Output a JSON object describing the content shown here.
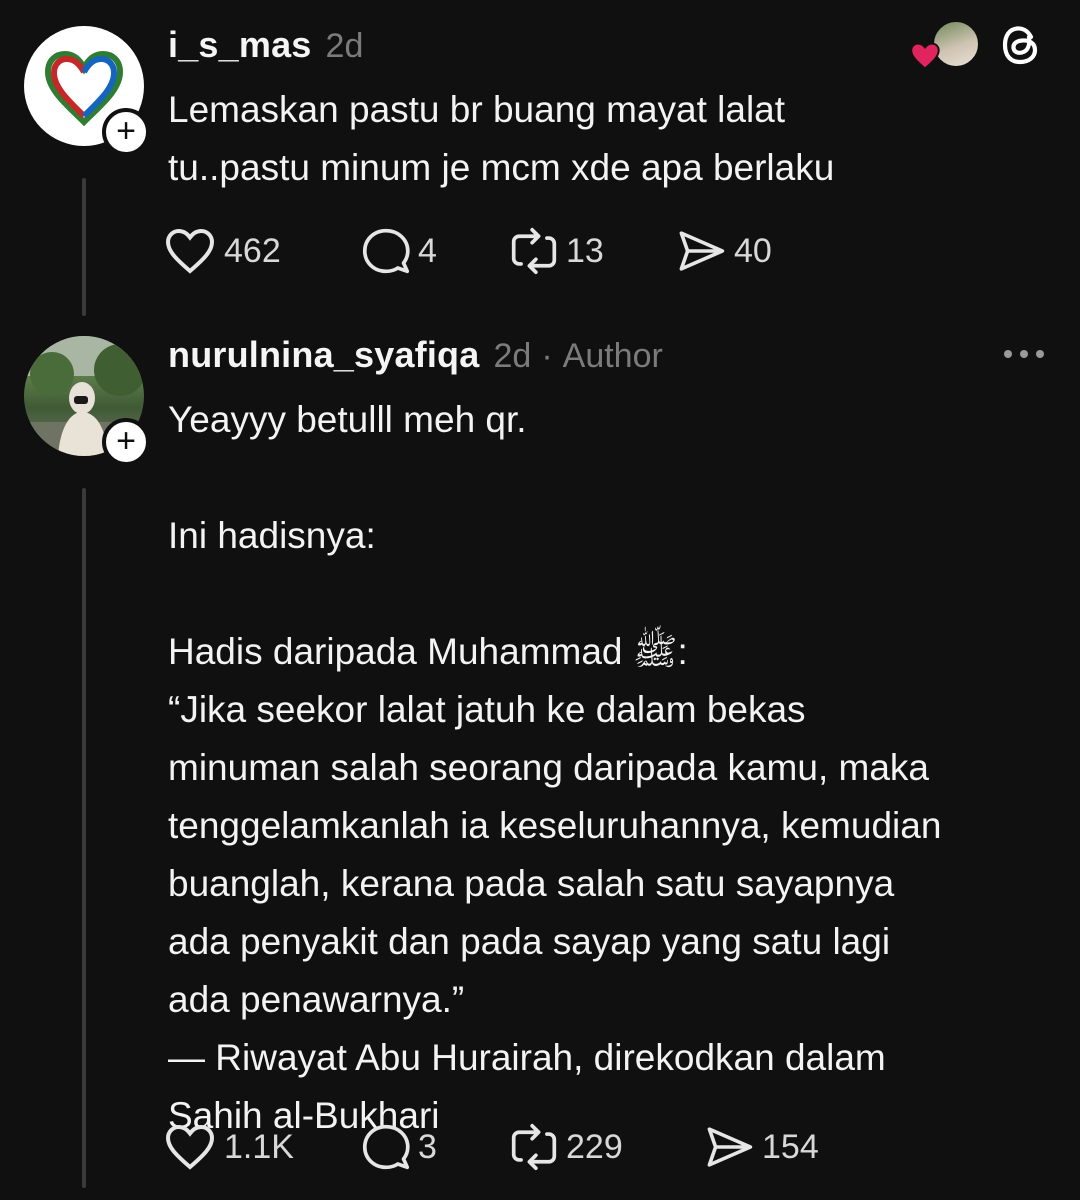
{
  "colors": {
    "background": "#101010",
    "text": "#f3f3f3",
    "muted": "#7b7b7b",
    "heart": "#e0245e"
  },
  "post1": {
    "username": "i_s_mas",
    "time": "2d",
    "text": "Lemaskan pastu br buang mayat lalat\ntu..pastu minum je mcm xde apa berlaku",
    "likes": "462",
    "replies": "4",
    "reposts": "13",
    "shares": "40",
    "liked_by_icon": "liked-by-avatar-with-heart",
    "app_icon": "threads-logo-icon"
  },
  "post2": {
    "username": "nurulnina_syafiqa",
    "time": "2d",
    "separator": "·",
    "author_badge": "Author",
    "text": "Yeayyy betulll meh qr.\n\nIni hadisnya:\n\nHadis daripada Muhammad ﷺ:\n“Jika seekor lalat jatuh ke dalam bekas\nminuman salah seorang daripada kamu, maka\ntenggelamkanlah ia keseluruhannya, kemudian\nbuanglah, kerana pada salah satu sayapnya\nada penyakit dan pada sayap yang satu lagi\nada penawarnya.”\n— Riwayat Abu Hurairah, direkodkan dalam\nSahih al-Bukhari",
    "likes": "1.1K",
    "replies": "3",
    "reposts": "229",
    "shares": "154",
    "more_icon": "more-options-icon"
  }
}
